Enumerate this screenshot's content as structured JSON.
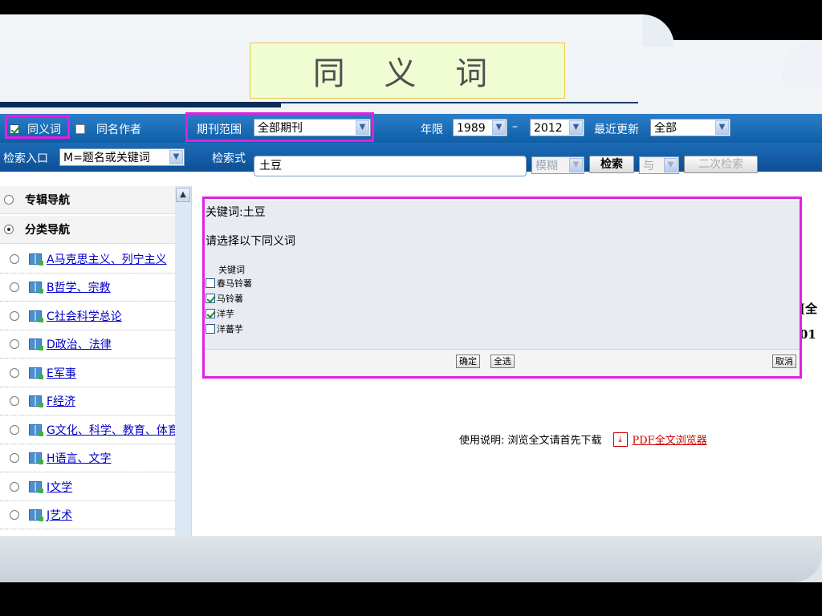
{
  "slide": {
    "title": "同 义 词"
  },
  "toolbar": {
    "synonym_label": "同义词",
    "synonym_checked": true,
    "same_author_label": "同名作者",
    "same_author_checked": false,
    "journal_scope_label": "期刊范围",
    "journal_scope_value": "全部期刊",
    "year_label": "年限",
    "year_from": "1989",
    "year_dash": "–",
    "year_to": "2012",
    "recent_update_label": "最近更新",
    "recent_update_value": "全部"
  },
  "search": {
    "entry_label": "检索入口",
    "entry_value": "M=题名或关键词",
    "expr_label": "检索式",
    "expr_value": "土豆",
    "match_value": "模糊",
    "search_button": "检索",
    "logic_value": "与",
    "secondary_button": "二次检索"
  },
  "nav": {
    "items": [
      {
        "label": "专辑导航",
        "kind": "head",
        "selected": false
      },
      {
        "label": "分类导航",
        "kind": "head",
        "selected": true
      },
      {
        "label": "A马克思主义、列宁主义",
        "kind": "link"
      },
      {
        "label": "B哲学、宗教",
        "kind": "link"
      },
      {
        "label": "C社会科学总论",
        "kind": "link"
      },
      {
        "label": "D政治、法律",
        "kind": "link"
      },
      {
        "label": "E军事",
        "kind": "link"
      },
      {
        "label": "F经济",
        "kind": "link"
      },
      {
        "label": "G文化、科学、教育、体育",
        "kind": "link"
      },
      {
        "label": "H语言、文字",
        "kind": "link"
      },
      {
        "label": "I文学",
        "kind": "link"
      },
      {
        "label": "J艺术",
        "kind": "link"
      }
    ]
  },
  "dialog": {
    "keyword_line": "关键词:土豆",
    "prompt": "请选择以下同义词",
    "column_header": "关键词",
    "options": [
      {
        "label": "春马铃薯",
        "checked": false
      },
      {
        "label": "马铃薯",
        "checked": true
      },
      {
        "label": "洋芋",
        "checked": true
      },
      {
        "label": "洋蕃芋",
        "checked": false
      }
    ],
    "confirm_button": "确定",
    "select_all_button": "全选",
    "cancel_button": "取消"
  },
  "content": {
    "right_fragment_1": "[全",
    "right_fragment_2": "01",
    "usage_label": "使用说明: 浏览全文请首先下载",
    "pdf_icon_glyph": "⤓",
    "pdf_link": "PDF全文浏览器"
  },
  "colors": {
    "highlight": "#e020e0",
    "toolbar_blue": "#0f5ea6",
    "title_bg": "#f0fcd2"
  }
}
